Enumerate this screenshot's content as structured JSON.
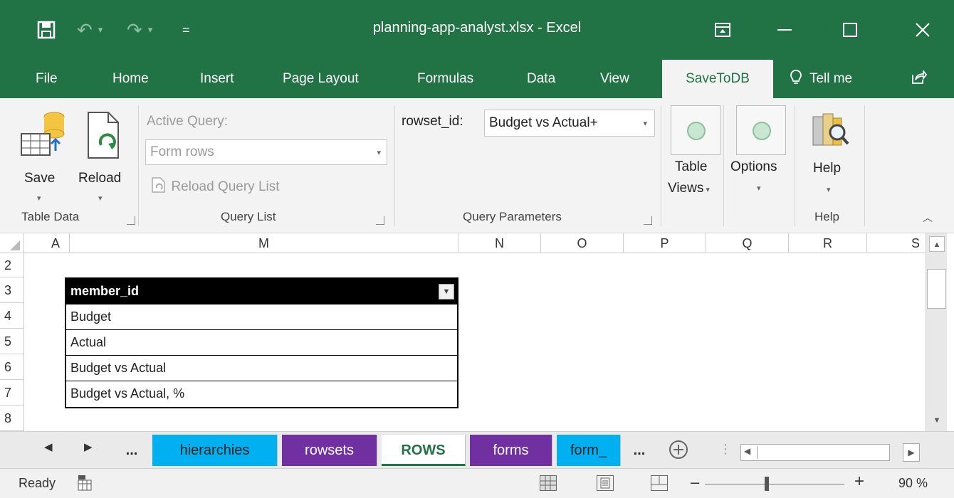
{
  "window": {
    "title": "planning-app-analyst.xlsx  -  Excel",
    "controls": [
      "restore-ribbon",
      "minimize",
      "maximize",
      "close"
    ]
  },
  "quick_access": {
    "save_glyph": "🖫",
    "undo_glyph": "↶",
    "redo_glyph": "↷",
    "customize_glyph": "▾"
  },
  "ribbon_tabs": [
    "File",
    "Home",
    "Insert",
    "Page Layout",
    "Formulas",
    "Data",
    "View",
    "SaveToDB",
    "Tell me"
  ],
  "active_tab": "SaveToDB",
  "ribbon": {
    "table_data": {
      "save_label": "Save",
      "reload_label": "Reload",
      "group_label": "Table Data"
    },
    "query_list": {
      "active_query_label": "Active Query:",
      "active_query_value": "Form rows",
      "reload_query_list_label": "Reload Query List",
      "group_label": "Query List"
    },
    "query_parameters": {
      "param_label": "rowset_id:",
      "param_value": "Budget vs Actual+",
      "group_label": "Query Parameters"
    },
    "table_views_label_1": "Table",
    "table_views_label_2": "Views",
    "options_label": "Options",
    "help_label": "Help",
    "help_group_label": "Help"
  },
  "columns": [
    "A",
    "M",
    "N",
    "O",
    "P",
    "Q",
    "R",
    "S"
  ],
  "rows": [
    "2",
    "3",
    "4",
    "5",
    "6",
    "7",
    "8"
  ],
  "table": {
    "header": "member_id",
    "rows": [
      "Budget",
      "Actual",
      "Budget vs Actual",
      "Budget vs Actual, %"
    ]
  },
  "sheet_tabs": {
    "ellipsis_left": "...",
    "items": [
      "hierarchies",
      "rowsets",
      "ROWS",
      "forms",
      "form_"
    ],
    "active": "ROWS",
    "ellipsis_right": "...",
    "colors": {
      "hierarchies": "#00b0f0",
      "rowsets": "#7030a0",
      "ROWS": "#ffffff",
      "forms": "#7030a0",
      "form_": "#00b0f0"
    }
  },
  "status": {
    "ready": "Ready",
    "zoom": "90 %",
    "zoom_minus": "–",
    "zoom_plus": "+"
  }
}
